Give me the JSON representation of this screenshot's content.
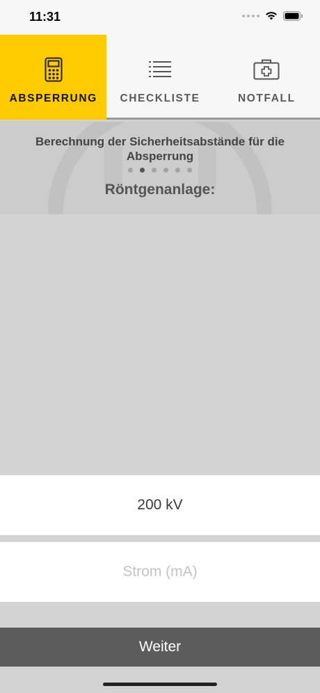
{
  "status_bar": {
    "time": "11:31"
  },
  "tabs": [
    {
      "label": "ABSPERRUNG",
      "icon": "calculator-icon",
      "active": true
    },
    {
      "label": "CHECKLISTE",
      "icon": "list-icon",
      "active": false
    },
    {
      "label": "NOTFALL",
      "icon": "first-aid-kit-icon",
      "active": false
    }
  ],
  "header": {
    "subtitle": "Berechnung der Sicherheitsabstände für die Absperrung",
    "page_index": 2,
    "page_count": 6,
    "section_title": "Röntgenanlage:"
  },
  "form": {
    "voltage_value": "200 kV",
    "current_placeholder": "Strom (mA)",
    "current_value": ""
  },
  "actions": {
    "next_label": "Weiter"
  },
  "colors": {
    "accent": "#fecb00",
    "background": "#d3d3d3",
    "button": "#5c5c5c"
  }
}
